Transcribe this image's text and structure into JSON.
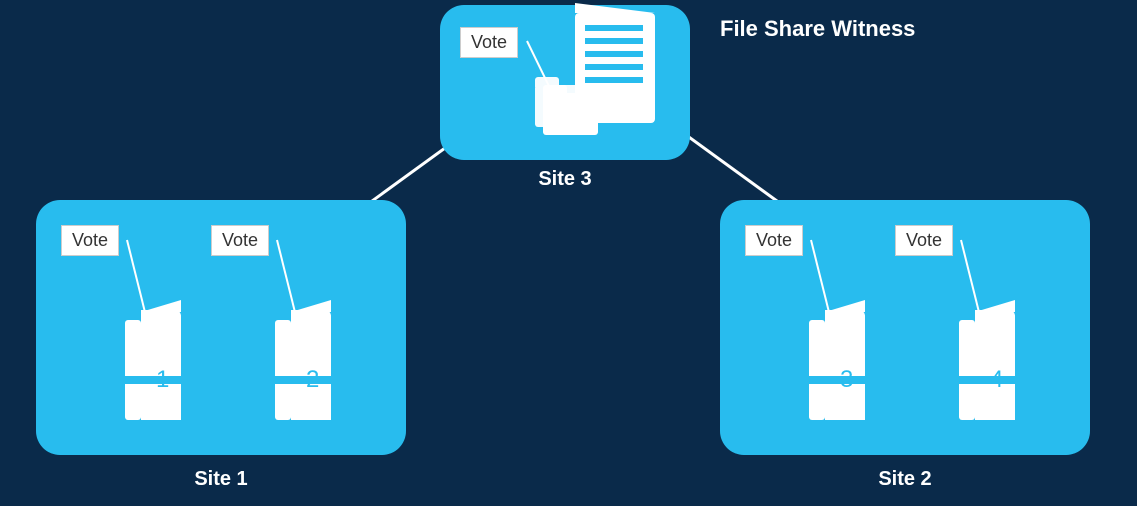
{
  "witness_title": "File Share Witness",
  "site3": {
    "label": "Site 3",
    "vote_label": "Vote"
  },
  "site1": {
    "label": "Site 1",
    "nodes": [
      {
        "vote_label": "Vote",
        "number": "1"
      },
      {
        "vote_label": "Vote",
        "number": "2"
      }
    ]
  },
  "site2": {
    "label": "Site 2",
    "nodes": [
      {
        "vote_label": "Vote",
        "number": "3"
      },
      {
        "vote_label": "Vote",
        "number": "4"
      }
    ]
  }
}
